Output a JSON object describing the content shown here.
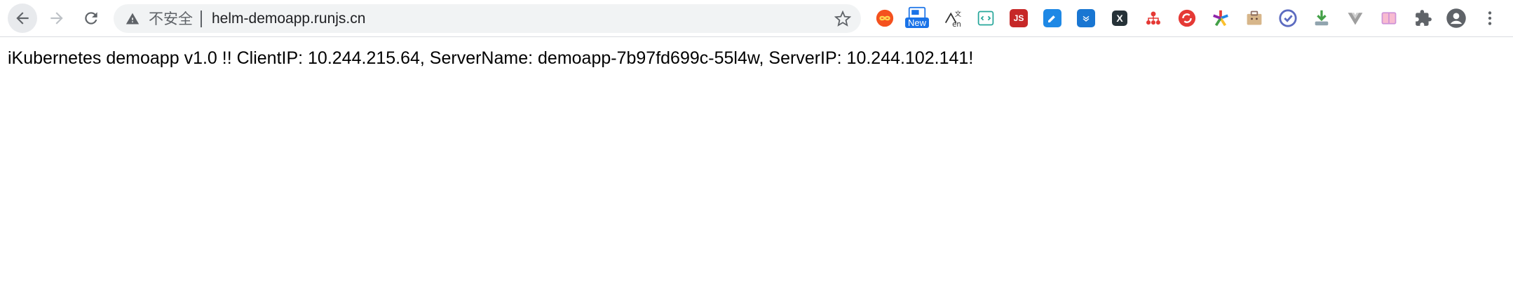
{
  "browser": {
    "nav": {
      "back_icon": "arrow-left-icon",
      "forward_icon": "arrow-right-icon",
      "reload_icon": "reload-icon"
    },
    "omnibox": {
      "security_icon": "warning-triangle-icon",
      "security_label": "不安全",
      "url": "helm-demoapp.runjs.cn",
      "bookmark_icon": "star-icon"
    },
    "extensions": {
      "new_badge": "New",
      "jsbadge": "JS",
      "x_label": "X"
    },
    "menu_icon": "vertical-dots-icon"
  },
  "page": {
    "body_text": "iKubernetes demoapp v1.0 !! ClientIP: 10.244.215.64, ServerName: demoapp-7b97fd699c-55l4w, ServerIP: 10.244.102.141!"
  },
  "colors": {
    "toolbar_bg": "#ffffff",
    "omnibox_bg": "#f1f3f4",
    "icon_gray": "#5f6368"
  }
}
